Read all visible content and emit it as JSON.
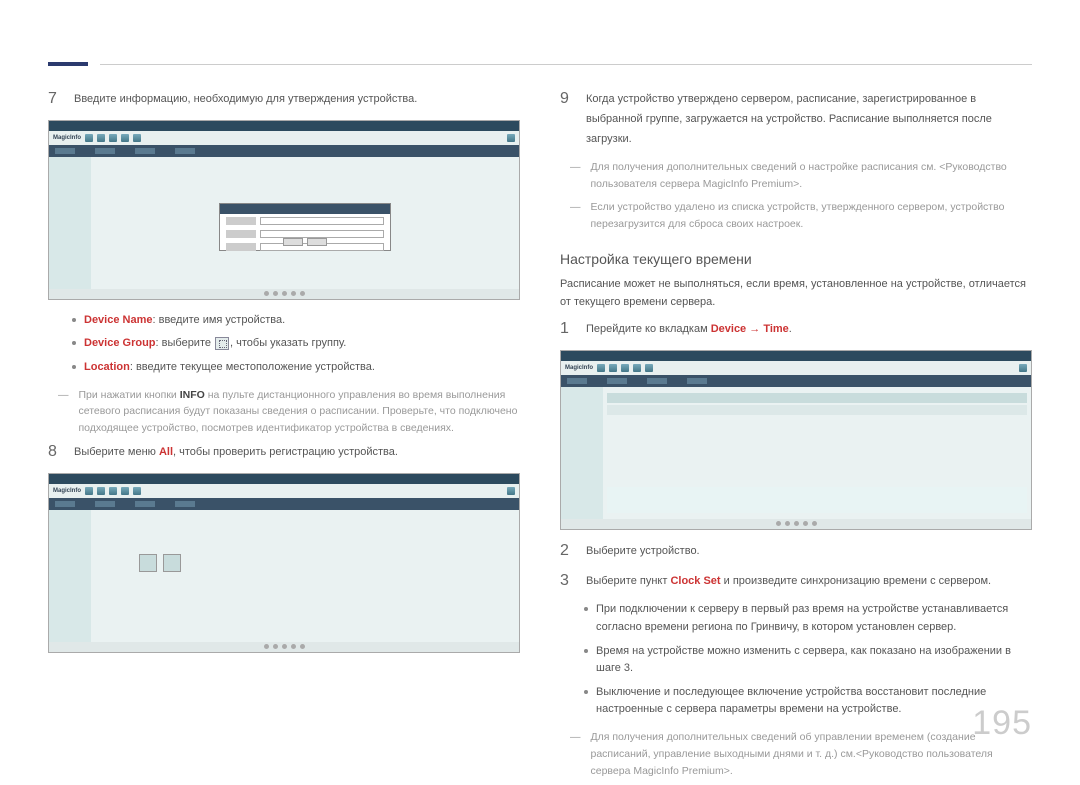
{
  "page_number": "195",
  "left": {
    "step7": "Введите информацию, необходимую для утверждения устройства.",
    "bullets": {
      "b1_label": "Device Name",
      "b1_text": ": введите имя устройства.",
      "b2_label": "Device Group",
      "b2_pre": ": выберите ",
      "b2_post": ", чтобы указать группу.",
      "b3_label": "Location",
      "b3_text": ": введите текущее местоположение устройства."
    },
    "note1_pre": "При нажатии кнопки ",
    "note1_bold": "INFO",
    "note1_post": " на пульте дистанционного управления во время выполнения сетевого расписания будут показаны сведения о расписании. Проверьте, что подключено подходящее устройство, посмотрев идентификатор устройства в сведениях.",
    "step8_pre": "Выберите меню ",
    "step8_red": "All",
    "step8_post": ", чтобы проверить регистрацию устройства."
  },
  "right": {
    "step9": "Когда устройство утверждено сервером, расписание, зарегистрированное в выбранной группе, загружается на устройство. Расписание выполняется после загрузки.",
    "note_r1": "Для получения дополнительных сведений о настройке расписания см. <Руководство пользователя сервера MagicInfo Premium>.",
    "note_r2": "Если устройство удалено из списка устройств, утвержденного сервером, устройство перезагрузится для сброса своих настроек.",
    "section_title": "Настройка текущего времени",
    "section_intro": "Расписание может не выполняться, если время, установленное на устройстве, отличается от текущего времени сервера.",
    "step1_pre": "Перейдите ко вкладкам ",
    "step1_red1": "Device",
    "step1_arrow": " → ",
    "step1_red2": "Time",
    "step1_post": ".",
    "step2": "Выберите устройство.",
    "step3_pre": "Выберите пункт ",
    "step3_red": "Clock Set",
    "step3_post": " и произведите синхронизацию времени с сервером.",
    "sub_bullets": {
      "s1": "При подключении к серверу в первый раз время на устройстве устанавливается согласно времени региона по Гринвичу, в котором установлен сервер.",
      "s2": "Время на устройстве можно изменить с сервера, как показано на изображении в шаге 3.",
      "s3": "Выключение и последующее включение устройства восстановит последние настроенные с сервера параметры времени на устройстве."
    },
    "note_r3": "Для получения дополнительных сведений об управлении временем (создание расписаний, управление выходными днями и т. д.) см.<Руководство пользователя сервера MagicInfo Premium>."
  }
}
